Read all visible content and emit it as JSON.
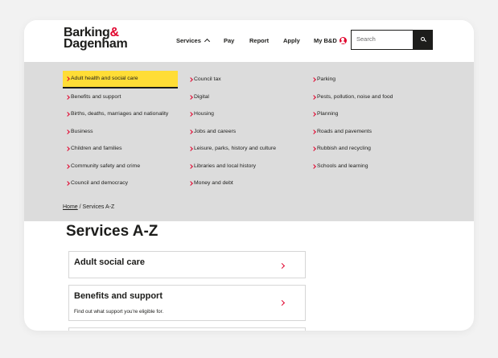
{
  "brand": {
    "line1": "Barking",
    "amp": "&",
    "line2": "Dagenham",
    "accent_color": "#e0002b",
    "highlight_color": "#ffdd36"
  },
  "nav": {
    "services": "Services",
    "pay": "Pay",
    "report": "Report",
    "apply": "Apply",
    "account": "My B&D"
  },
  "search": {
    "placeholder": "Search"
  },
  "menu": {
    "col1": [
      "Adult health and social care",
      "Benefits and support",
      "Births, deaths, marriages and nationality",
      "Business",
      "Children and families",
      "Community safety and crime",
      "Council and democracy"
    ],
    "col2": [
      "Council tax",
      "Digital",
      "Housing",
      "Jobs and careers",
      "Leisure, parks, history and culture",
      "Libraries and local history",
      "Money and debt"
    ],
    "col3": [
      "Parking",
      "Pests, pollution, noise and food",
      "Planning",
      "Roads and pavements",
      "Rubbish and recycling",
      "Schools and learning"
    ]
  },
  "breadcrumb": {
    "home": "Home",
    "separator": "/",
    "current": "Services A-Z"
  },
  "page": {
    "title": "Services A-Z"
  },
  "services": [
    {
      "name": "Adult social care",
      "description": ""
    },
    {
      "name": "Benefits and support",
      "description": "Find out what support you're eligible for."
    }
  ]
}
